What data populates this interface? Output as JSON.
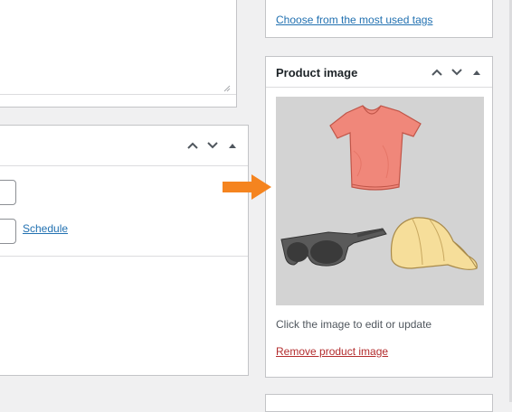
{
  "tags_panel": {
    "most_used_link": "Choose from the most used tags"
  },
  "product_image": {
    "title": "Product image",
    "hint": "Click the image to edit or update",
    "remove_link": "Remove product image"
  },
  "publish_panel": {
    "schedule_link": "Schedule"
  },
  "colors": {
    "accent": "#2271b1",
    "danger": "#b32d2e",
    "arrow": "#f5841f",
    "image_bg": "#d3d3d3"
  }
}
